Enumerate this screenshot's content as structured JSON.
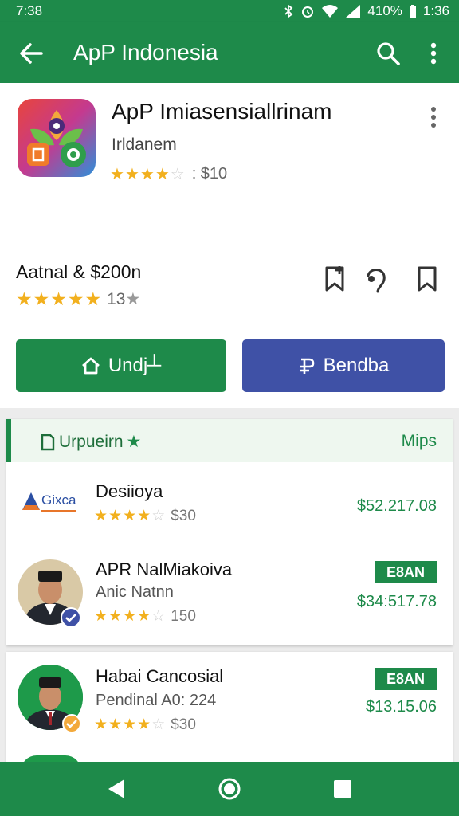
{
  "status_bar": {
    "time": "7:38",
    "battery_text": "410%",
    "clock_right": "1:36"
  },
  "app_bar": {
    "title": "ApP Indonesia"
  },
  "app": {
    "name": "ApP Imiasensiallrinam",
    "developer": "Irldanem",
    "rating_stars": 3.5,
    "rating_text": ": $10"
  },
  "info": {
    "title": "Aatnal & $200n",
    "rating_stars": 4.5,
    "rating_count": "13"
  },
  "buttons": {
    "install_label": "Undj┴",
    "buy_label": "Bendba"
  },
  "list": {
    "header_label": "Urpueirn",
    "header_right": "Mips",
    "items": [
      {
        "logo_text": "Gixca",
        "title": "Desiioya",
        "subtitle": "",
        "rating_stars": 4,
        "rating_text": "$30",
        "price": "$52.217.08",
        "badge": ""
      },
      {
        "title": "APR NalMiakoiva",
        "subtitle": "Anic Natnn",
        "rating_stars": 4,
        "rating_text": "150",
        "price": "$34:517.78",
        "badge": "E8AN"
      },
      {
        "title": "Habai Cancosial",
        "subtitle": "Pendinal A0: 224",
        "rating_stars": 4,
        "rating_text": "$30",
        "price": "$13.15.06",
        "badge": "E8AN"
      }
    ]
  },
  "colors": {
    "primary_green": "#1e8a4a",
    "buy_blue": "#3f51a6",
    "star_gold": "#f2b01e"
  },
  "icons": [
    "back-arrow-icon",
    "search-icon",
    "more-vert-icon",
    "bookmark-add-icon",
    "share-icon",
    "bookmark-icon",
    "home-icon",
    "currency-icon",
    "document-icon",
    "star-icon",
    "verified-icon",
    "nav-back-icon",
    "nav-home-icon",
    "nav-recents-icon"
  ]
}
